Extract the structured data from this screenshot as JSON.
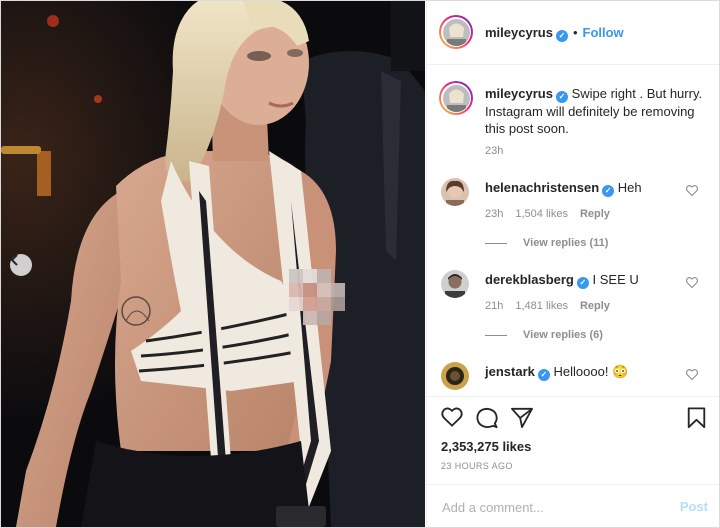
{
  "header": {
    "username": "mileycyrus",
    "follow_label": "Follow"
  },
  "caption": {
    "username": "mileycyrus",
    "text": "Swipe right . But hurry. Instagram will definitely be removing this post soon.",
    "time": "23h"
  },
  "comments": [
    {
      "username": "helenachristensen",
      "text": "Heh",
      "time": "23h",
      "likes": "1,504 likes",
      "reply_label": "Reply",
      "view_replies": "View replies (11)"
    },
    {
      "username": "derekblasberg",
      "text": "I SEE U",
      "time": "21h",
      "likes": "1,481 likes",
      "reply_label": "Reply",
      "view_replies": "View replies (6)"
    },
    {
      "username": "jenstark",
      "text": "Helloooo! 😳"
    }
  ],
  "actions": {
    "likes": "2,353,275 likes",
    "time_ago": "23 HOURS AGO"
  },
  "add_comment": {
    "placeholder": "Add a comment...",
    "post_label": "Post"
  },
  "icons": {
    "like": "heart-icon",
    "comment": "comment-icon",
    "share": "paper-plane-icon",
    "save": "bookmark-icon",
    "prev": "chevron-left-icon",
    "verified": "verified-badge-icon"
  },
  "colors": {
    "accent": "#3897f0",
    "text": "#262626",
    "muted": "#8e8e8e",
    "post_disabled": "#b2dffc"
  }
}
